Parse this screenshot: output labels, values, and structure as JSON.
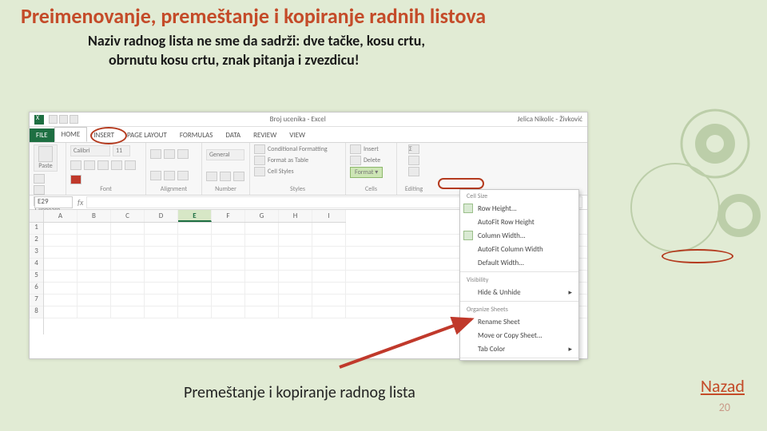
{
  "slide": {
    "title": "Preimenovanje, premeštanje i kopiranje radnih listova",
    "subtitle_line1": "Naziv radnog lista ne sme  da sadrži: dve tačke, kosu crtu,",
    "subtitle_line2": "obrnutu kosu crtu, znak pitanja i zvezdicu!",
    "caption": "Premeštanje i kopiranje radnog lista",
    "back_label": "Nazad",
    "page_number": "20"
  },
  "excel": {
    "workbook_title": "Broj ucenika - Excel",
    "user": "Jelica Nikolic - Živković",
    "tabs": [
      "FILE",
      "HOME",
      "INSERT",
      "PAGE LAYOUT",
      "FORMULAS",
      "DATA",
      "REVIEW",
      "VIEW"
    ],
    "active_tab": "HOME",
    "namebox": "E29",
    "columns": [
      "A",
      "B",
      "C",
      "D",
      "E",
      "F",
      "G",
      "H",
      "I"
    ],
    "active_column": "E",
    "rows": [
      "1",
      "2",
      "3",
      "4",
      "5",
      "6",
      "7",
      "8"
    ],
    "ribbon_groups": {
      "clipboard": {
        "label": "Clipboard",
        "paste": "Paste"
      },
      "font": {
        "label": "Font",
        "family": "Calibri",
        "size": "11"
      },
      "alignment": {
        "label": "Alignment"
      },
      "number": {
        "label": "Number",
        "format": "General"
      },
      "styles": {
        "label": "Styles",
        "cond": "Conditional Formatting",
        "tbl": "Format as Table",
        "cell": "Cell Styles"
      },
      "cells": {
        "label": "Cells",
        "ins": "Insert",
        "del": "Delete",
        "fmt": "Format"
      },
      "editing": {
        "label": "Editing"
      }
    },
    "format_menu": {
      "sec_cellsize": "Cell Size",
      "row_height": "Row Height...",
      "autofit_row": "AutoFit Row Height",
      "col_width": "Column Width...",
      "autofit_col": "AutoFit Column Width",
      "default_width": "Default Width...",
      "sec_visibility": "Visibility",
      "hide": "Hide & Unhide",
      "sec_organize": "Organize Sheets",
      "rename": "Rename Sheet",
      "move": "Move or Copy Sheet...",
      "tabcolor": "Tab Color"
    }
  }
}
